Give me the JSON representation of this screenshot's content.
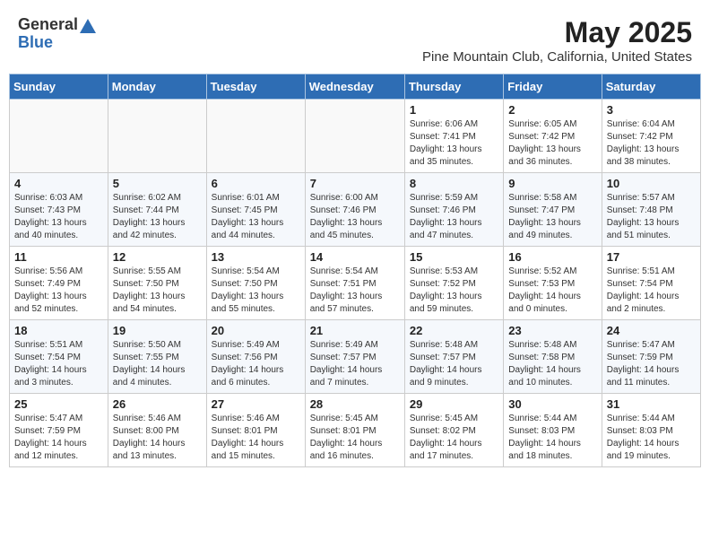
{
  "header": {
    "logo_general": "General",
    "logo_blue": "Blue",
    "title": "May 2025",
    "subtitle": "Pine Mountain Club, California, United States"
  },
  "weekdays": [
    "Sunday",
    "Monday",
    "Tuesday",
    "Wednesday",
    "Thursday",
    "Friday",
    "Saturday"
  ],
  "weeks": [
    [
      {
        "day": "",
        "info": ""
      },
      {
        "day": "",
        "info": ""
      },
      {
        "day": "",
        "info": ""
      },
      {
        "day": "",
        "info": ""
      },
      {
        "day": "1",
        "info": "Sunrise: 6:06 AM\nSunset: 7:41 PM\nDaylight: 13 hours\nand 35 minutes."
      },
      {
        "day": "2",
        "info": "Sunrise: 6:05 AM\nSunset: 7:42 PM\nDaylight: 13 hours\nand 36 minutes."
      },
      {
        "day": "3",
        "info": "Sunrise: 6:04 AM\nSunset: 7:42 PM\nDaylight: 13 hours\nand 38 minutes."
      }
    ],
    [
      {
        "day": "4",
        "info": "Sunrise: 6:03 AM\nSunset: 7:43 PM\nDaylight: 13 hours\nand 40 minutes."
      },
      {
        "day": "5",
        "info": "Sunrise: 6:02 AM\nSunset: 7:44 PM\nDaylight: 13 hours\nand 42 minutes."
      },
      {
        "day": "6",
        "info": "Sunrise: 6:01 AM\nSunset: 7:45 PM\nDaylight: 13 hours\nand 44 minutes."
      },
      {
        "day": "7",
        "info": "Sunrise: 6:00 AM\nSunset: 7:46 PM\nDaylight: 13 hours\nand 45 minutes."
      },
      {
        "day": "8",
        "info": "Sunrise: 5:59 AM\nSunset: 7:46 PM\nDaylight: 13 hours\nand 47 minutes."
      },
      {
        "day": "9",
        "info": "Sunrise: 5:58 AM\nSunset: 7:47 PM\nDaylight: 13 hours\nand 49 minutes."
      },
      {
        "day": "10",
        "info": "Sunrise: 5:57 AM\nSunset: 7:48 PM\nDaylight: 13 hours\nand 51 minutes."
      }
    ],
    [
      {
        "day": "11",
        "info": "Sunrise: 5:56 AM\nSunset: 7:49 PM\nDaylight: 13 hours\nand 52 minutes."
      },
      {
        "day": "12",
        "info": "Sunrise: 5:55 AM\nSunset: 7:50 PM\nDaylight: 13 hours\nand 54 minutes."
      },
      {
        "day": "13",
        "info": "Sunrise: 5:54 AM\nSunset: 7:50 PM\nDaylight: 13 hours\nand 55 minutes."
      },
      {
        "day": "14",
        "info": "Sunrise: 5:54 AM\nSunset: 7:51 PM\nDaylight: 13 hours\nand 57 minutes."
      },
      {
        "day": "15",
        "info": "Sunrise: 5:53 AM\nSunset: 7:52 PM\nDaylight: 13 hours\nand 59 minutes."
      },
      {
        "day": "16",
        "info": "Sunrise: 5:52 AM\nSunset: 7:53 PM\nDaylight: 14 hours\nand 0 minutes."
      },
      {
        "day": "17",
        "info": "Sunrise: 5:51 AM\nSunset: 7:54 PM\nDaylight: 14 hours\nand 2 minutes."
      }
    ],
    [
      {
        "day": "18",
        "info": "Sunrise: 5:51 AM\nSunset: 7:54 PM\nDaylight: 14 hours\nand 3 minutes."
      },
      {
        "day": "19",
        "info": "Sunrise: 5:50 AM\nSunset: 7:55 PM\nDaylight: 14 hours\nand 4 minutes."
      },
      {
        "day": "20",
        "info": "Sunrise: 5:49 AM\nSunset: 7:56 PM\nDaylight: 14 hours\nand 6 minutes."
      },
      {
        "day": "21",
        "info": "Sunrise: 5:49 AM\nSunset: 7:57 PM\nDaylight: 14 hours\nand 7 minutes."
      },
      {
        "day": "22",
        "info": "Sunrise: 5:48 AM\nSunset: 7:57 PM\nDaylight: 14 hours\nand 9 minutes."
      },
      {
        "day": "23",
        "info": "Sunrise: 5:48 AM\nSunset: 7:58 PM\nDaylight: 14 hours\nand 10 minutes."
      },
      {
        "day": "24",
        "info": "Sunrise: 5:47 AM\nSunset: 7:59 PM\nDaylight: 14 hours\nand 11 minutes."
      }
    ],
    [
      {
        "day": "25",
        "info": "Sunrise: 5:47 AM\nSunset: 7:59 PM\nDaylight: 14 hours\nand 12 minutes."
      },
      {
        "day": "26",
        "info": "Sunrise: 5:46 AM\nSunset: 8:00 PM\nDaylight: 14 hours\nand 13 minutes."
      },
      {
        "day": "27",
        "info": "Sunrise: 5:46 AM\nSunset: 8:01 PM\nDaylight: 14 hours\nand 15 minutes."
      },
      {
        "day": "28",
        "info": "Sunrise: 5:45 AM\nSunset: 8:01 PM\nDaylight: 14 hours\nand 16 minutes."
      },
      {
        "day": "29",
        "info": "Sunrise: 5:45 AM\nSunset: 8:02 PM\nDaylight: 14 hours\nand 17 minutes."
      },
      {
        "day": "30",
        "info": "Sunrise: 5:44 AM\nSunset: 8:03 PM\nDaylight: 14 hours\nand 18 minutes."
      },
      {
        "day": "31",
        "info": "Sunrise: 5:44 AM\nSunset: 8:03 PM\nDaylight: 14 hours\nand 19 minutes."
      }
    ]
  ]
}
